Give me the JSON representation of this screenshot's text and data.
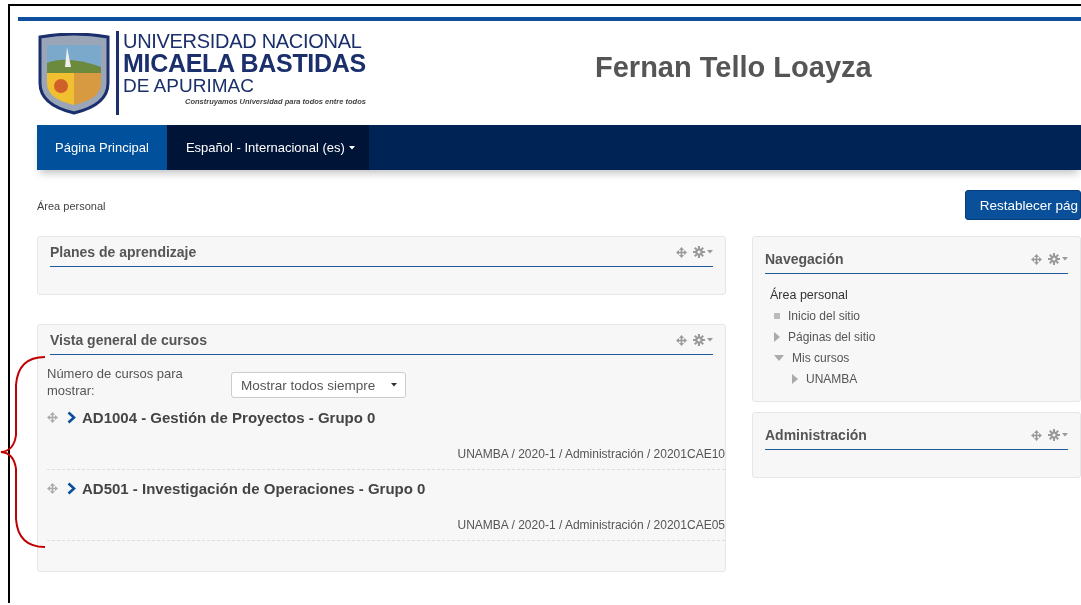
{
  "header": {
    "logo": {
      "line_1": "UNIVERSIDAD NACIONAL",
      "line_2": "MICAELA BASTIDAS",
      "line_3": "DE APURIMAC",
      "tagline": "Construyamos Universidad para todos entre todos"
    },
    "user_name": "Fernan Tello Loayza"
  },
  "navbar": {
    "items": [
      {
        "label": "Página Principal",
        "selected": true,
        "kind": "link"
      },
      {
        "label": "Español - Internacional (es)",
        "selected": false,
        "kind": "dropdown"
      }
    ]
  },
  "breadcrumb": [
    "Área personal"
  ],
  "reset_button": "Restablecer pág",
  "main_blocks": [
    {
      "title": "Planes de aprendizaje",
      "kind": "empty"
    },
    {
      "title": "Vista general de cursos",
      "kind": "courses",
      "setting_label": "Número de cursos para mostrar:",
      "setting_value": "Mostrar todos siempre",
      "courses": [
        {
          "name": "AD1004 - Gestión de Proyectos - Grupo 0",
          "path": "UNAMBA / 2020-1 / Administración / 20201CAE10"
        },
        {
          "name": "AD501 - Investigación de Operaciones - Grupo 0",
          "path": "UNAMBA / 2020-1 / Administración / 20201CAE05"
        }
      ]
    }
  ],
  "side_blocks": [
    {
      "title": "Navegación",
      "tree": [
        {
          "label": "Área personal",
          "kind": "root",
          "children": [
            {
              "label": "Inicio del sitio",
              "kind": "leaf"
            },
            {
              "label": "Páginas del sitio",
              "kind": "branch",
              "expanded": false
            },
            {
              "label": "Mis cursos",
              "kind": "branch",
              "expanded": true,
              "children": [
                {
                  "label": "UNAMBA",
                  "kind": "branch",
                  "expanded": false
                }
              ]
            }
          ]
        }
      ]
    },
    {
      "title": "Administración"
    }
  ]
}
